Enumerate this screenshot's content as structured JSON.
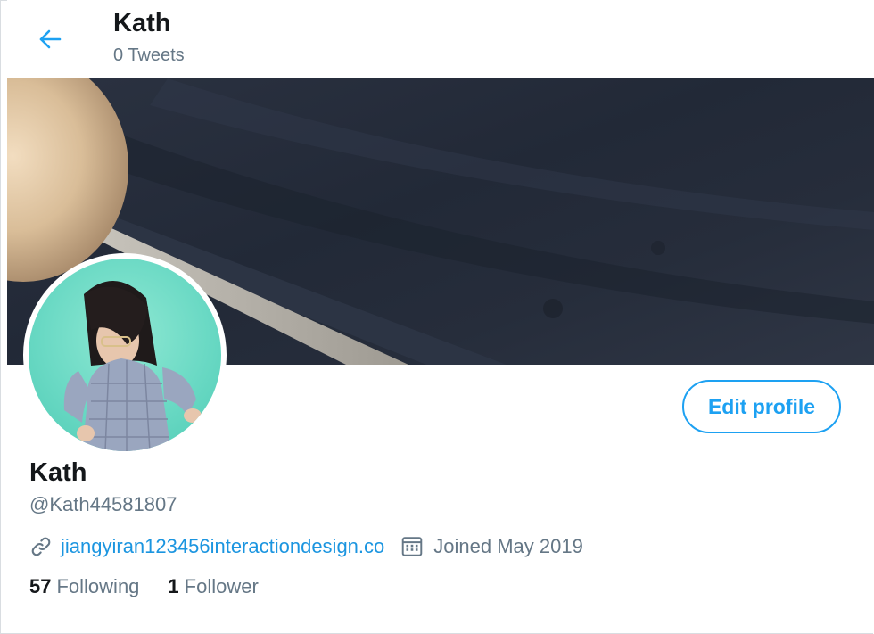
{
  "header": {
    "title": "Kath",
    "tweet_count": "0 Tweets"
  },
  "profile": {
    "name": "Kath",
    "handle": "@Kath44581807",
    "website": "jiangyiran123456interactiondesign.co",
    "joined": "Joined May 2019",
    "edit_label": "Edit profile"
  },
  "stats": {
    "following_count": "57",
    "following_label": "Following",
    "followers_count": "1",
    "followers_label": "Follower"
  },
  "icons": {
    "back": "arrow-left-icon",
    "link": "link-icon",
    "calendar": "calendar-icon"
  },
  "colors": {
    "accent": "#1da1f2",
    "link": "#1b95e0",
    "secondary_text": "#657786",
    "primary_text": "#14171a",
    "banner": "#232a38",
    "avatar_bg": "#6ad9c4"
  }
}
